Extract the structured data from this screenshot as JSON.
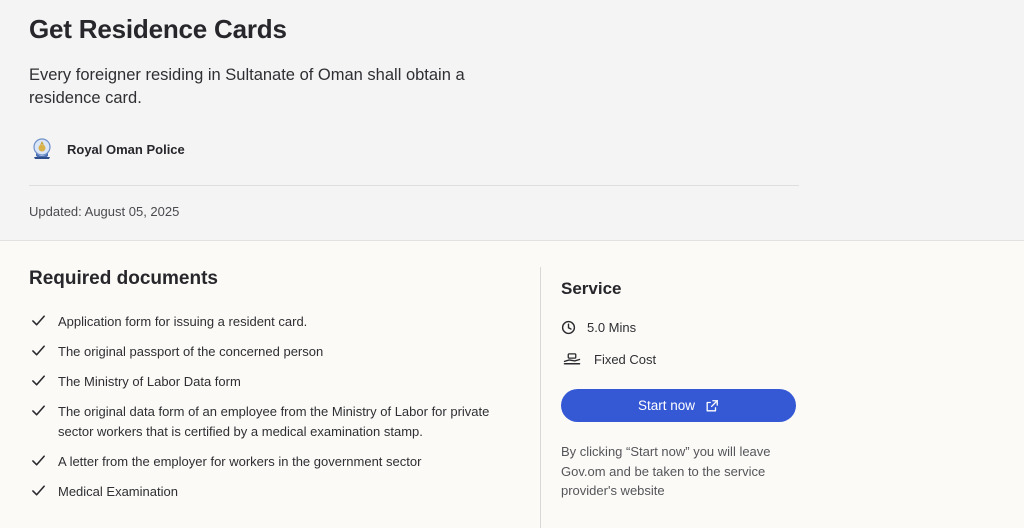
{
  "page": {
    "title": "Get Residence Cards",
    "description": "Every foreigner residing in Sultanate of Oman shall obtain a residence card.",
    "provider": {
      "name": "Royal Oman Police",
      "icon": "royal-oman-police-emblem"
    },
    "updated": "Updated: August 05, 2025"
  },
  "documents": {
    "heading": "Required documents",
    "items": [
      "Application form for issuing a resident card.",
      "The original passport of the concerned person",
      "The Ministry of Labor Data form",
      "The original data form of an employee from the Ministry of Labor for private sector workers that is certified by a medical examination stamp.",
      "A letter from the employer for workers in the government sector",
      "Medical Examination"
    ]
  },
  "service": {
    "heading": "Service",
    "duration": "5.0 Mins",
    "cost": "Fixed Cost",
    "start_label": "Start now",
    "notice": "By clicking “Start now” you will leave Gov.om and be taken to the service provider's website"
  },
  "colors": {
    "accent": "#3558d4",
    "hero_bg": "#f4f4f5",
    "page_bg": "#fbfaf7"
  }
}
